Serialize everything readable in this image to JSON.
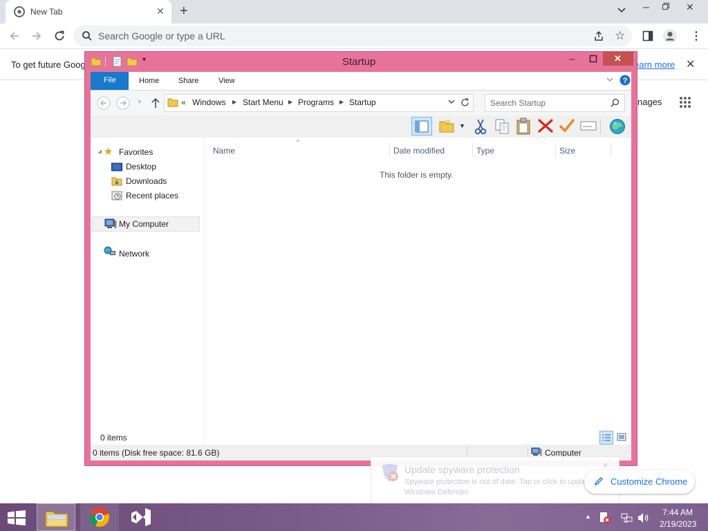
{
  "chrome": {
    "tab_title": "New Tab",
    "omnibox_placeholder": "Search Google or type a URL",
    "infobar_text": "To get future Goog",
    "infobar_link": "earn more",
    "apps_partial_label": "nages",
    "customize_label": "Customize Chrome"
  },
  "explorer": {
    "title": "Startup",
    "ribbon_tabs": [
      "File",
      "Home",
      "Share",
      "View"
    ],
    "breadcrumb": {
      "prefix": "«",
      "segments": [
        "Windows",
        "Start Menu",
        "Programs",
        "Startup"
      ]
    },
    "search_placeholder": "Search Startup",
    "nav": {
      "favorites_label": "Favorites",
      "favorites": [
        "Desktop",
        "Downloads",
        "Recent places"
      ],
      "computer_label": "My Computer",
      "network_label": "Network"
    },
    "columns": [
      "Name",
      "Date modified",
      "Type",
      "Size"
    ],
    "empty_message": "This folder is empty.",
    "item_count": "0 items",
    "status_left": "0 items (Disk free space: 81.6 GB)",
    "status_right": "Computer"
  },
  "notification": {
    "title": "Update spyware protection",
    "body_line1": "Spyware protection is out of date. Tap or click to update",
    "body_line2": "Windows Defender."
  },
  "taskbar": {
    "clock_time": "7:44 AM",
    "clock_date": "2/19/2023"
  },
  "colors": {
    "window_frame": "#e8739a",
    "file_tab": "#1979ca",
    "close_red": "#c75050",
    "taskbar": "#6b4a78"
  }
}
